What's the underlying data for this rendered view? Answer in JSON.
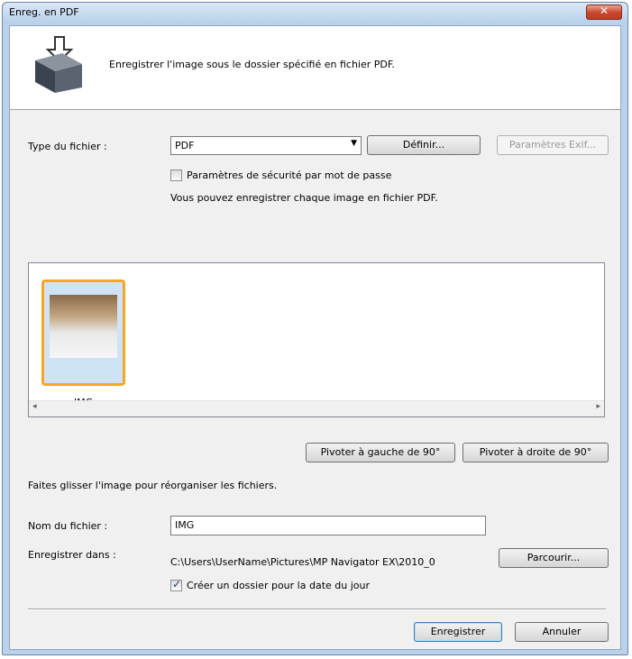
{
  "window": {
    "title": "Enreg. en PDF",
    "close_glyph": "✕"
  },
  "banner": {
    "icon": "save-to-folder-icon",
    "text": "Enregistrer l'image sous le dossier spécifié en fichier PDF."
  },
  "file_type": {
    "label": "Type du fichier :",
    "value": "PDF",
    "arrow": "▼",
    "define_button": "Définir...",
    "exif_button": "Paramètres Exif..."
  },
  "password_checkbox": {
    "label": "Paramètres de sécurité par mot de passe",
    "checked": false
  },
  "info_text": "Vous pouvez enregistrer chaque image en fichier PDF.",
  "thumbnails": [
    {
      "label": "IMG"
    }
  ],
  "scroll": {
    "left": "◂",
    "right": "▸"
  },
  "rotate": {
    "left": "Pivoter à gauche de 90°",
    "right": "Pivoter à droite de 90°"
  },
  "drag_hint": "Faites glisser l'image pour réorganiser les fichiers.",
  "filename": {
    "label": "Nom du fichier :",
    "value": "IMG"
  },
  "save_in": {
    "label": "Enregistrer dans :",
    "path": "C:\\Users\\UserName\\Pictures\\MP Navigator EX\\2010_0",
    "browse": "Parcourir..."
  },
  "date_folder_checkbox": {
    "label": "Créer un dossier pour la date du jour",
    "checked": true,
    "mark": "✓"
  },
  "actions": {
    "save": "Enregistrer",
    "cancel": "Annuler"
  }
}
